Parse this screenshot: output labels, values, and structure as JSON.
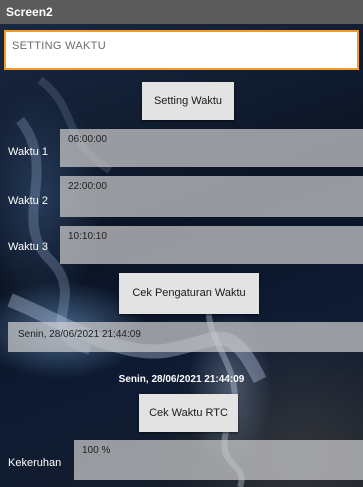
{
  "window": {
    "title": "Screen2"
  },
  "header": {
    "text": "SETTING WAKTU"
  },
  "buttons": {
    "setting": "Setting Waktu",
    "cek_pengaturan": "Cek Pengaturan Waktu",
    "cek_rtc": "Cek Waktu RTC"
  },
  "times": [
    {
      "label": "Waktu 1",
      "value": "06:00:00"
    },
    {
      "label": "Waktu 2",
      "value": "22:00:00"
    },
    {
      "label": "Waktu 3",
      "value": "10:10:10"
    }
  ],
  "datetime_field": "Senin, 28/06/2021  21:44:09",
  "rtc_label": "Senin, 28/06/2021  21:44:09",
  "turbidity": {
    "label": "Kekeruhan",
    "value": "100 %"
  }
}
